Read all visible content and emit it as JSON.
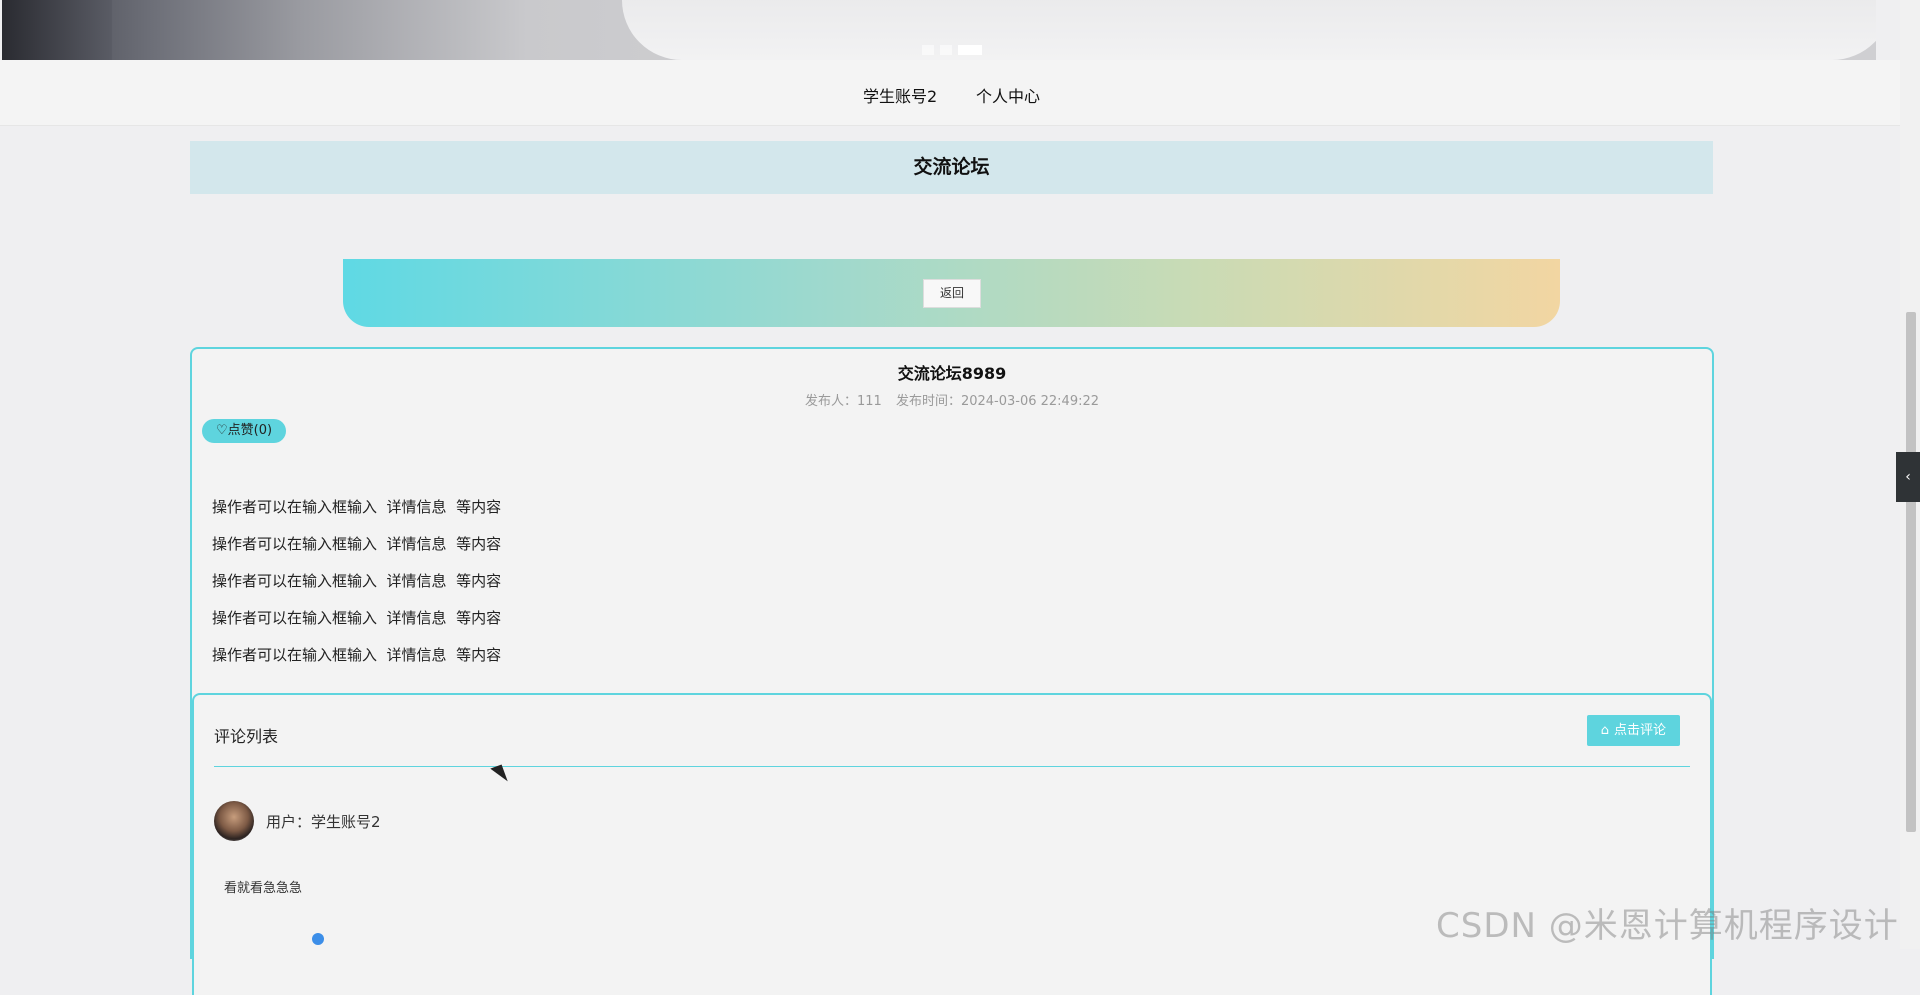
{
  "nav": {
    "items": [
      {
        "label": "学生账号2"
      },
      {
        "label": "个人中心"
      }
    ]
  },
  "page": {
    "title": "交流论坛"
  },
  "back": {
    "label": "返回"
  },
  "post": {
    "title": "交流论坛8989",
    "author_label": "发布人：111",
    "time_label": "发布时间：2024-03-06 22:49:22",
    "like_label": "点赞(0)",
    "content_lines": [
      "操作者可以在输入框输入  详情信息  等内容",
      "操作者可以在输入框输入  详情信息  等内容",
      "操作者可以在输入框输入  详情信息  等内容",
      "操作者可以在输入框输入  详情信息  等内容",
      "操作者可以在输入框输入  详情信息  等内容"
    ]
  },
  "comments": {
    "header": "评论列表",
    "button_label": "点击评论",
    "items": [
      {
        "user": "用户：学生账号2",
        "text": "看就看急急急"
      }
    ]
  },
  "watermark": "CSDN @米恩计算机程序设计",
  "icons": {
    "like": "heart-icon",
    "comment_button": "home-icon",
    "side_toggle": "chevron-left-icon"
  },
  "colors": {
    "accent": "#5ed4de",
    "title_bar": "#d3e7ec"
  }
}
